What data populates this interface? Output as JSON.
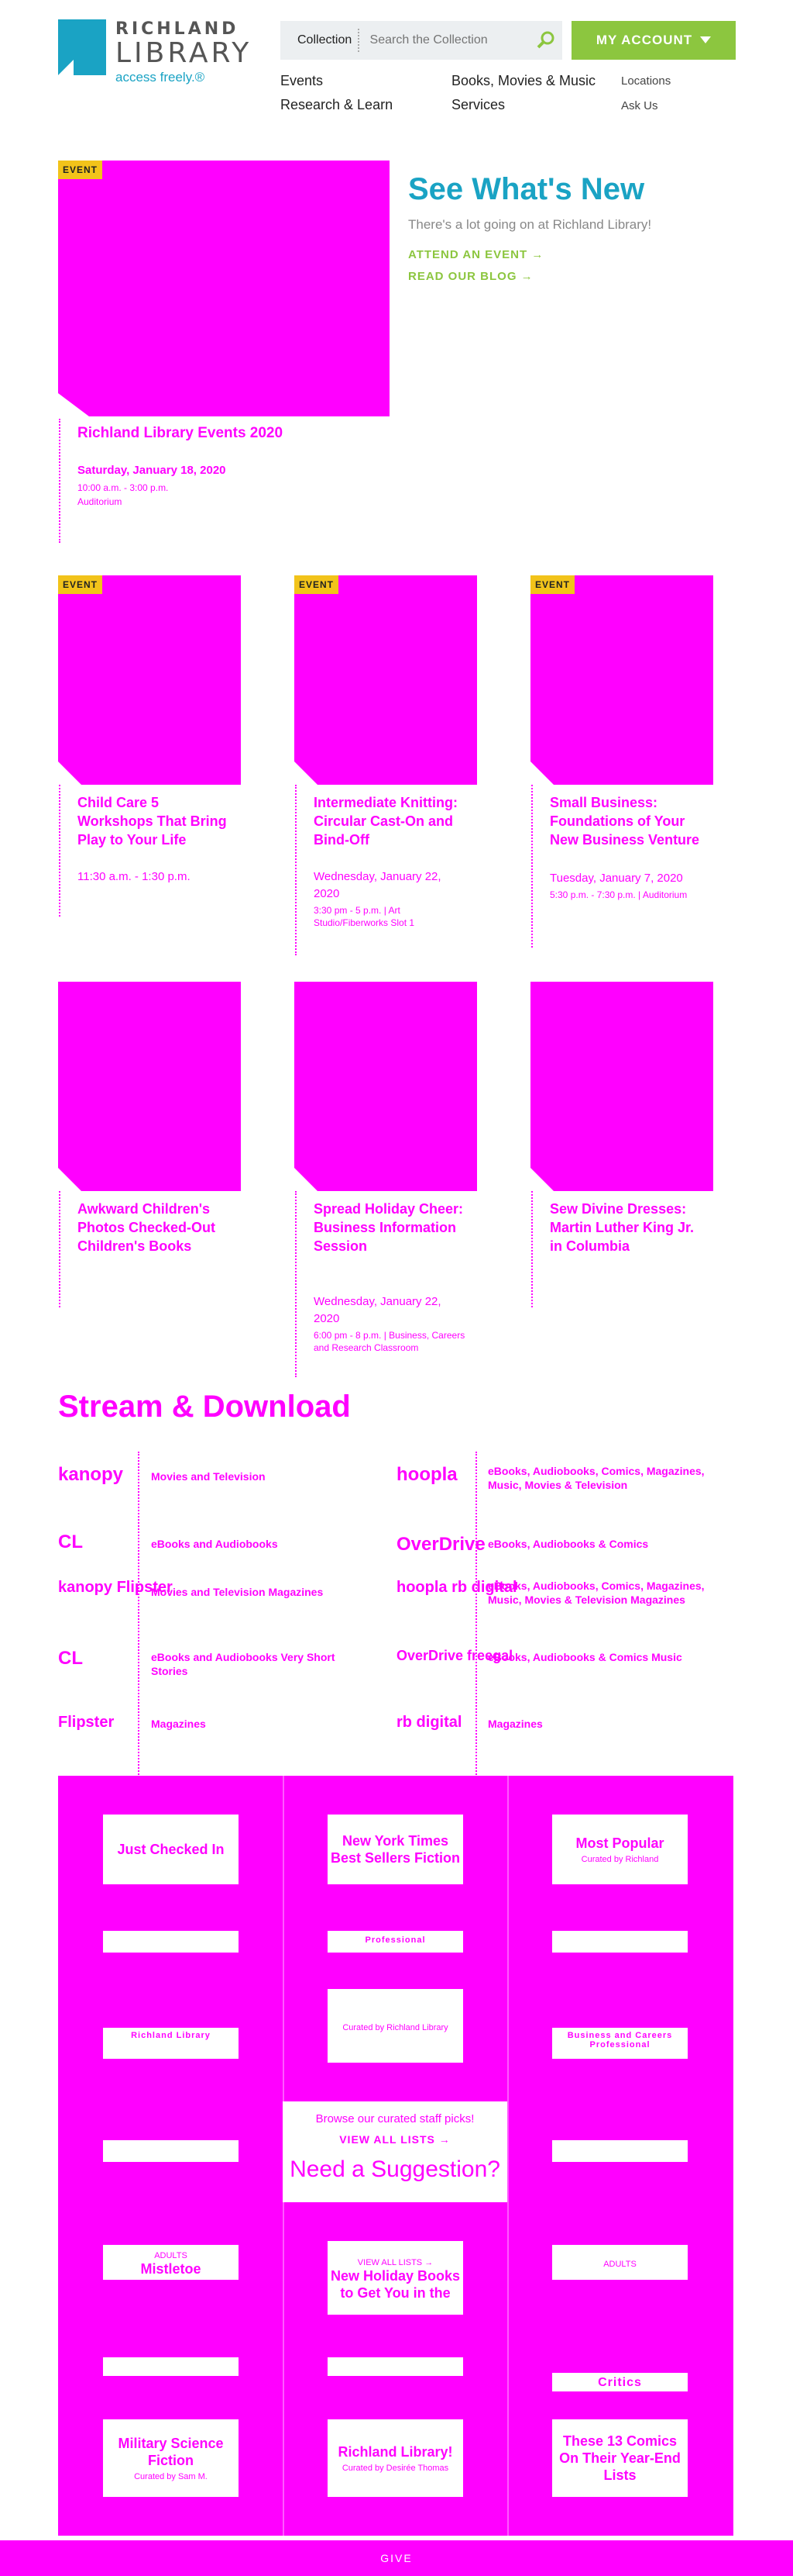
{
  "brand": {
    "line1": "RICHLAND",
    "line2": "LIBRARY",
    "tagline": "access freely.®"
  },
  "search": {
    "scope": "Collection",
    "placeholder": "Search the Collection"
  },
  "account_label": "MY ACCOUNT",
  "nav": {
    "primary": [
      "Events",
      "Books, Movies & Music",
      "Research & Learn",
      "Services"
    ],
    "secondary": [
      "Locations",
      "Ask Us"
    ]
  },
  "featured": {
    "badge": "EVENT",
    "title": "Richland Library Events 2020",
    "date": "Saturday, January 18, 2020",
    "time": "10:00 a.m. - 3:00 p.m.",
    "location": "Auditorium"
  },
  "whats_new": {
    "heading": "See What's New",
    "sub": "There's a lot going on at Richland Library!",
    "cta1": "ATTEND AN EVENT →",
    "cta2": "READ OUR BLOG →"
  },
  "cards_row1": [
    {
      "badge": "EVENT",
      "title": "Child Care 5 Workshops That Bring Play to Your Life",
      "date": "11:30 a.m. - 1:30 p.m.",
      "meta": ""
    },
    {
      "badge": "EVENT",
      "title": "Intermediate Knitting: Circular Cast-On and Bind-Off",
      "date": "Wednesday, January 22, 2020",
      "meta": "3:30 pm - 5 p.m. | Art Studio/Fiberworks Slot 1"
    },
    {
      "badge": "EVENT",
      "title": "Small Business: Foundations of Your New Business Venture",
      "date": "Tuesday, January 7, 2020",
      "meta": "5:30 p.m. - 7:30 p.m. | Auditorium"
    }
  ],
  "cards_row2": [
    {
      "title": "Awkward Children's Photos Checked-Out Children's Books",
      "date": "",
      "meta": ""
    },
    {
      "title": "Spread Holiday Cheer: Business Information Session",
      "date": "Wednesday, January 22, 2020",
      "meta": "6:00 pm - 8 p.m. | Business, Careers and Research Classroom"
    },
    {
      "title": "Sew Divine Dresses: Martin Luther King Jr. in Columbia",
      "date": "",
      "meta": ""
    }
  ],
  "stream": {
    "heading": "Stream & Download",
    "services": [
      {
        "logo": "kanopy",
        "desc": "Movies and Television"
      },
      {
        "logo": "hoopla",
        "desc": "eBooks, Audiobooks, Comics, Magazines, Music, Movies & Television"
      },
      {
        "logo": "CL",
        "desc": "eBooks and Audiobooks"
      },
      {
        "logo": "OverDrive",
        "desc": "eBooks, Audiobooks & Comics"
      },
      {
        "logo": "kanopy Flipster",
        "desc": "Movies and Television Magazines"
      },
      {
        "logo": "hoopla rb digital",
        "desc": "eBooks, Audiobooks, Comics, Magazines, Music, Movies & Television Magazines"
      },
      {
        "logo": "CL",
        "desc": "eBooks and Audiobooks Very Short Stories"
      },
      {
        "logo": "OverDrive freegal",
        "desc": "eBooks, Audiobooks & Comics Music"
      },
      {
        "logo": "Flipster",
        "desc": "Magazines"
      },
      {
        "logo": "rb digital",
        "desc": "Magazines"
      }
    ]
  },
  "lists": {
    "tiles": [
      {
        "title": "Just Checked In",
        "sub": ""
      },
      {
        "title": "New York Times Best Sellers Fiction",
        "sub": ""
      },
      {
        "title": "Most Popular",
        "sub": "Curated by Richland"
      },
      {
        "title": "",
        "sub": "Professional"
      },
      {
        "title": "",
        "sub": "Curated by Richland Library"
      },
      {
        "title": "",
        "sub": "Richland Library"
      },
      {
        "title": "",
        "sub": "Business and Careers Professional"
      },
      {
        "title": "Mistletoe",
        "sub": "ADULTS"
      },
      {
        "title": "New Holiday Books to Get You in the",
        "sub": ""
      },
      {
        "title": "Critics",
        "sub": "ADULTS"
      },
      {
        "title": "Military Science Fiction",
        "sub": "Curated by Sam M."
      },
      {
        "title": "Richland Library!",
        "sub": "Curated by Desirée Thomas"
      },
      {
        "title": "These 13 Comics On Their Year-End Lists",
        "sub": ""
      }
    ],
    "promo_text": "Browse our curated staff picks!",
    "view_all": "VIEW ALL LISTS →",
    "suggestion": "Need a Suggestion?",
    "need_a": "Need a",
    "view_all2": "VIEW ALL LISTS →"
  },
  "footer": "GIVE"
}
